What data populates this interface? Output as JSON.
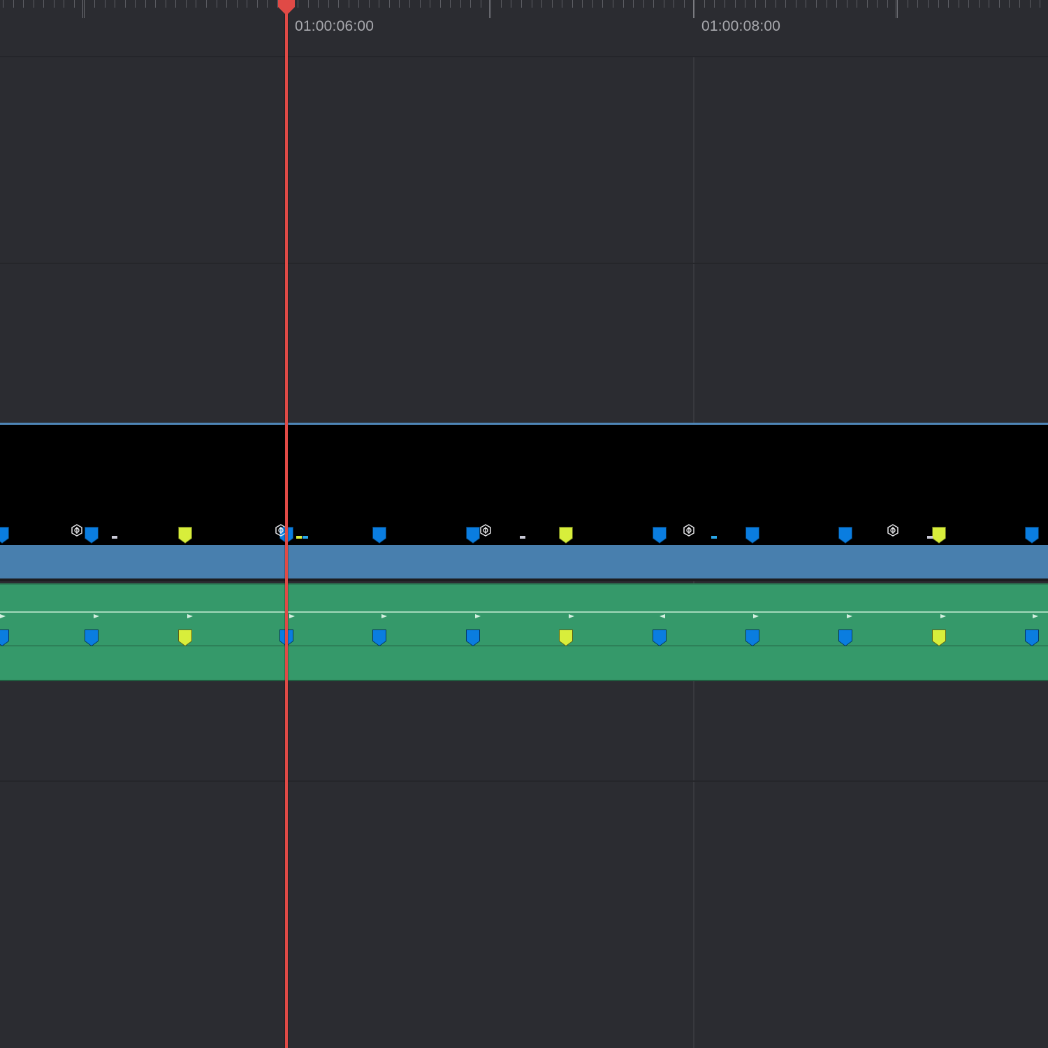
{
  "ruler": {
    "timecodes": [
      "01:00:06:00",
      "01:00:08:00"
    ]
  },
  "colors": {
    "background": "#2b2c31",
    "playhead": "#e04a46",
    "video_bar": "#487fae",
    "audio_clip": "#35996a",
    "marker_blue": "#0a7de0",
    "marker_yellow": "#d8ee3b"
  },
  "markers": {
    "colors_in_sequence": [
      "blue",
      "blue",
      "yellow",
      "blue",
      "blue",
      "blue",
      "yellow",
      "blue",
      "blue",
      "blue",
      "yellow",
      "blue"
    ]
  },
  "icons": [
    "fx-icon",
    "marker-icon",
    "playhead-icon",
    "keyframe-arrow-icon"
  ]
}
